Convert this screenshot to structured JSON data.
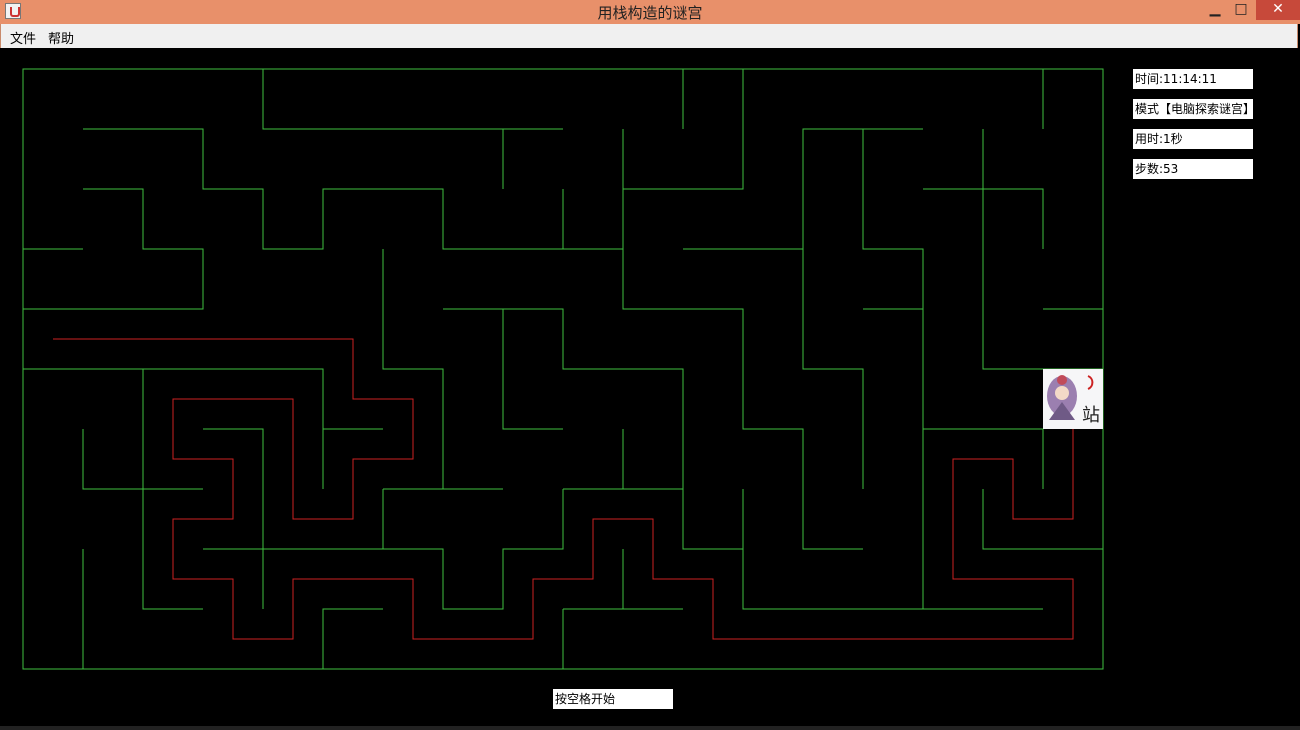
{
  "window": {
    "title": "用栈构造的谜宫",
    "minimize_glyph": "▁",
    "maximize_glyph": "□",
    "close_glyph": "✕"
  },
  "menu": {
    "file": "文件",
    "help": "帮助"
  },
  "status": {
    "time": "时间:11:14:11",
    "mode": "模式【电脑探索谜宫】",
    "elapsed": "用时:1秒",
    "steps": "步数:53"
  },
  "start_prompt": "按空格开始",
  "colors": {
    "wall": "#3fbf3f",
    "path": "#cc2222",
    "background": "#000000",
    "titlebar": "#e8906a"
  },
  "character": {
    "icon": "girl-sprite-icon",
    "label": "站"
  }
}
